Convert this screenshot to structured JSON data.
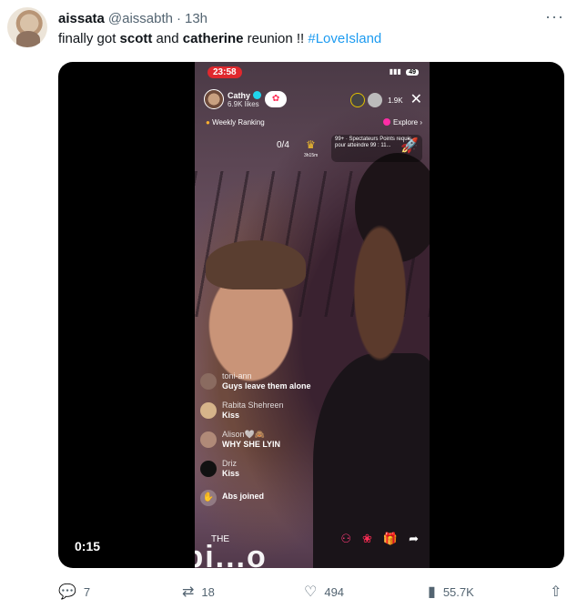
{
  "tweet": {
    "display_name": "aissata",
    "handle": "@aissabth",
    "separator": "·",
    "time": "13h",
    "more": "···",
    "text": {
      "part1": "finally got ",
      "bold1": "scott",
      "part2": " and ",
      "bold2": "catherine",
      "part3": " reunion !! ",
      "hashtag": "#LoveIsland"
    }
  },
  "video": {
    "timestamp": "0:15",
    "status_time": "23:58",
    "battery": "49",
    "host": {
      "name": "Cathy",
      "likes": "6.9K likes"
    },
    "viewer_count": "1.9K",
    "close": "✕",
    "weekly_ranking": "Weekly Ranking",
    "explore": "Explore ›",
    "goal_count": "0/4",
    "crown_sub": "3h15m",
    "spectators_text": "99+ · Spectateurs Points requis pour atteindre 99 : 11...",
    "comments": [
      {
        "user": "toni-ann",
        "text": "Guys leave them alone",
        "avatar_color": "#8a6b60"
      },
      {
        "user": "Rabita Shehreen",
        "text": "Kiss",
        "avatar_color": "#d6b48a"
      },
      {
        "user": "Alison🤍🙈",
        "text": "WHY SHE LYIN",
        "avatar_color": "#b08a78"
      },
      {
        "user": "Driz",
        "text": "Kiss",
        "avatar_color": "#111111"
      }
    ],
    "joined": {
      "user_text": "Abs joined"
    },
    "bottom_caption": "THE",
    "overlay_text": "Obi...o"
  },
  "actions": {
    "replies": "7",
    "retweets": "18",
    "likes": "494",
    "views": "55.7K"
  }
}
